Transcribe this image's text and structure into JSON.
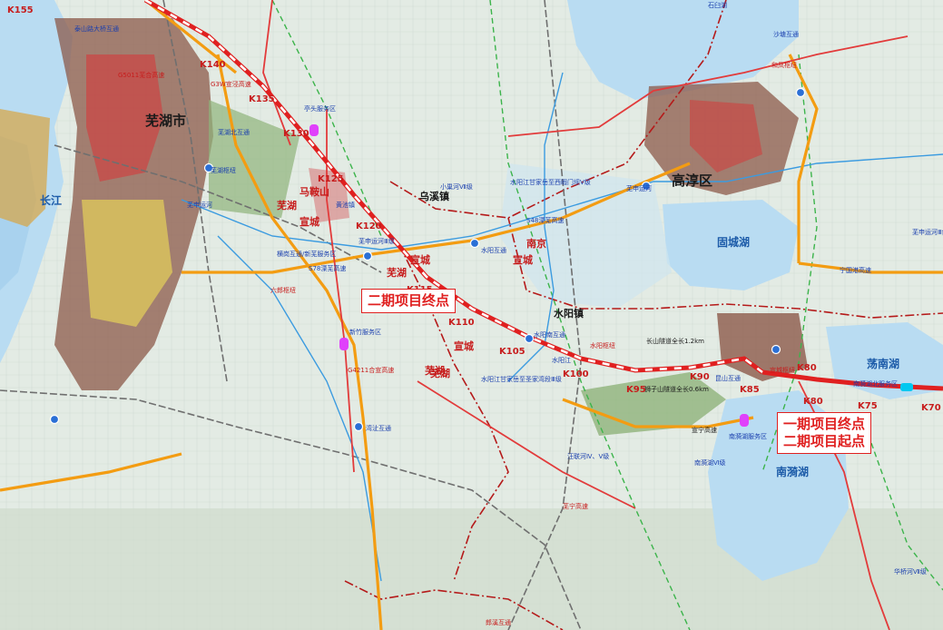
{
  "colors": {
    "highway_new": "#e02020",
    "highway": "#f39c12",
    "red_road": "#e23b3b",
    "rail": "#6f6f6f",
    "water": "#b9dcf2",
    "river": "#3b9be0",
    "boundary": "#b51a1a",
    "green_route": "#3cb44b",
    "urban": "#8c5a4a",
    "farmland": "#e5ece6"
  },
  "labels": {
    "cities": [
      {
        "text": "芜湖市"
      },
      {
        "text": "高淳区"
      }
    ],
    "regions": [
      {
        "text": "芜湖"
      },
      {
        "text": "宣城"
      },
      {
        "text": "南京"
      },
      {
        "text": "宣城"
      },
      {
        "text": "芜湖"
      },
      {
        "text": "宣城"
      },
      {
        "text": "芜湖"
      },
      {
        "text": "宣城"
      }
    ],
    "water": [
      {
        "text": "长江"
      },
      {
        "text": "固城湖"
      },
      {
        "text": "南漪湖"
      },
      {
        "text": "荡南湖"
      }
    ],
    "towns": [
      {
        "text": "乌溪镇"
      },
      {
        "text": "马鞍山"
      },
      {
        "text": "水阳镇"
      },
      {
        "text": "芜湖"
      }
    ],
    "interchanges": [
      {
        "text": "泰山路大桥互通"
      },
      {
        "text": "芜湖北互通"
      },
      {
        "text": "芜湖枢纽"
      },
      {
        "text": "芜申运河"
      },
      {
        "text": "黄池镇"
      },
      {
        "text": "横岗互通/新芜服务区"
      },
      {
        "text": "S78溧芜高速"
      },
      {
        "text": "六郎枢纽"
      },
      {
        "text": "新竹服务区"
      },
      {
        "text": "湾沚互通"
      },
      {
        "text": "水阳互通"
      },
      {
        "text": "水阳南互通"
      },
      {
        "text": "水阳枢纽"
      },
      {
        "text": "水阳江"
      },
      {
        "text": "小巢河Ⅶ级"
      },
      {
        "text": "水阳江甘家岳至西暇门坝Ⅴ级"
      },
      {
        "text": "水阳江甘家岳至圣家湾段Ⅲ级"
      },
      {
        "text": "芜申运河Ⅲ级"
      },
      {
        "text": "芜申运河"
      },
      {
        "text": "S48溧芜高速"
      },
      {
        "text": "长山隧道全长1.2km"
      },
      {
        "text": "狮子山隧道全长0.6km"
      },
      {
        "text": "昆山互通"
      },
      {
        "text": "南漪湖服务区"
      },
      {
        "text": "南漪湖北服务区"
      },
      {
        "text": "宁国港高速"
      },
      {
        "text": "沙塘互通"
      },
      {
        "text": "和凤枢纽"
      },
      {
        "text": "亭头服务区"
      },
      {
        "text": "芜申运河Ⅲ级"
      },
      {
        "text": "G3W宣泾高速"
      },
      {
        "text": "宣城枢纽"
      },
      {
        "text": "南漪湖Ⅵ级"
      },
      {
        "text": "汪联河Ⅳ、Ⅴ级"
      },
      {
        "text": "华桥河Ⅶ级"
      },
      {
        "text": "G4211合宣高速"
      },
      {
        "text": "宣宁高速"
      },
      {
        "text": "芜宁高速"
      },
      {
        "text": "G5011芜合高速"
      },
      {
        "text": "郎溪互通"
      },
      {
        "text": "石臼湖"
      }
    ],
    "kilometer_posts": [
      {
        "text": "K155"
      },
      {
        "text": "K140"
      },
      {
        "text": "K135"
      },
      {
        "text": "K130"
      },
      {
        "text": "K125"
      },
      {
        "text": "K120"
      },
      {
        "text": "K115"
      },
      {
        "text": "K110"
      },
      {
        "text": "K105"
      },
      {
        "text": "K100"
      },
      {
        "text": "K95"
      },
      {
        "text": "K90"
      },
      {
        "text": "K85"
      },
      {
        "text": "K80"
      },
      {
        "text": "K80"
      },
      {
        "text": "K75"
      },
      {
        "text": "K70"
      }
    ]
  },
  "callouts": [
    {
      "text": "二期项目终点"
    },
    {
      "line1": "一期项目终点",
      "line2": "二期项目起点"
    }
  ]
}
